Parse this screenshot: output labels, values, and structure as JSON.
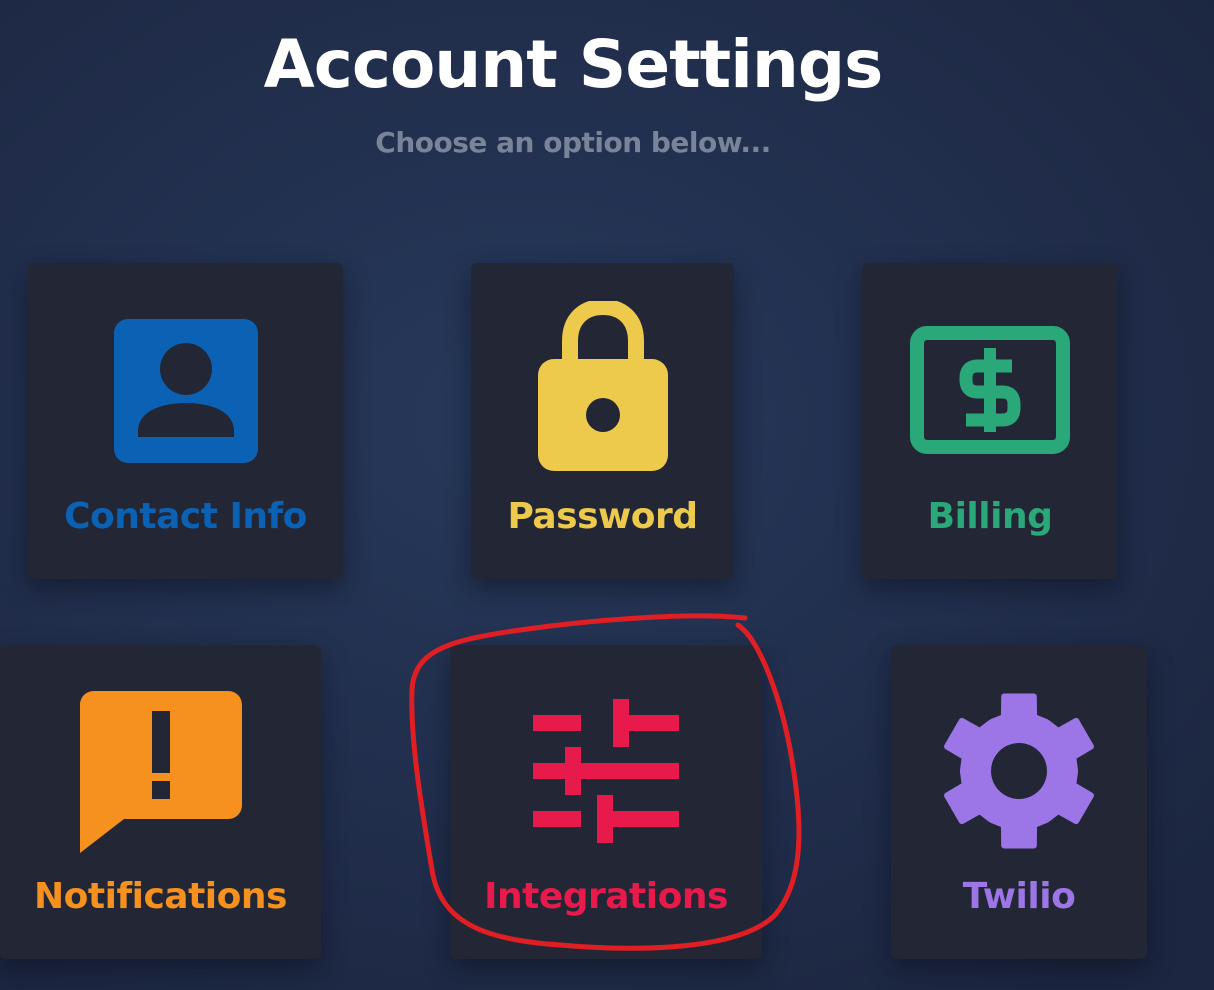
{
  "header": {
    "title": "Account Settings",
    "subtitle": "Choose an option below..."
  },
  "options": [
    {
      "label": "Contact Info",
      "icon": "contact-card-icon",
      "color": "#0b62b5"
    },
    {
      "label": "Password",
      "icon": "lock-icon",
      "color": "#edc94c"
    },
    {
      "label": "Billing",
      "icon": "billing-dollar-icon",
      "color": "#2aa87a"
    },
    {
      "label": "Notifications",
      "icon": "alert-message-icon",
      "color": "#f6901e"
    },
    {
      "label": "Integrations",
      "icon": "sliders-icon",
      "color": "#e8194b"
    },
    {
      "label": "Twilio",
      "icon": "gear-icon",
      "color": "#9c75e6"
    }
  ],
  "annotation": {
    "shape": "circle",
    "color": "#e01f24",
    "target": "Integrations"
  },
  "background_color": "#243355"
}
